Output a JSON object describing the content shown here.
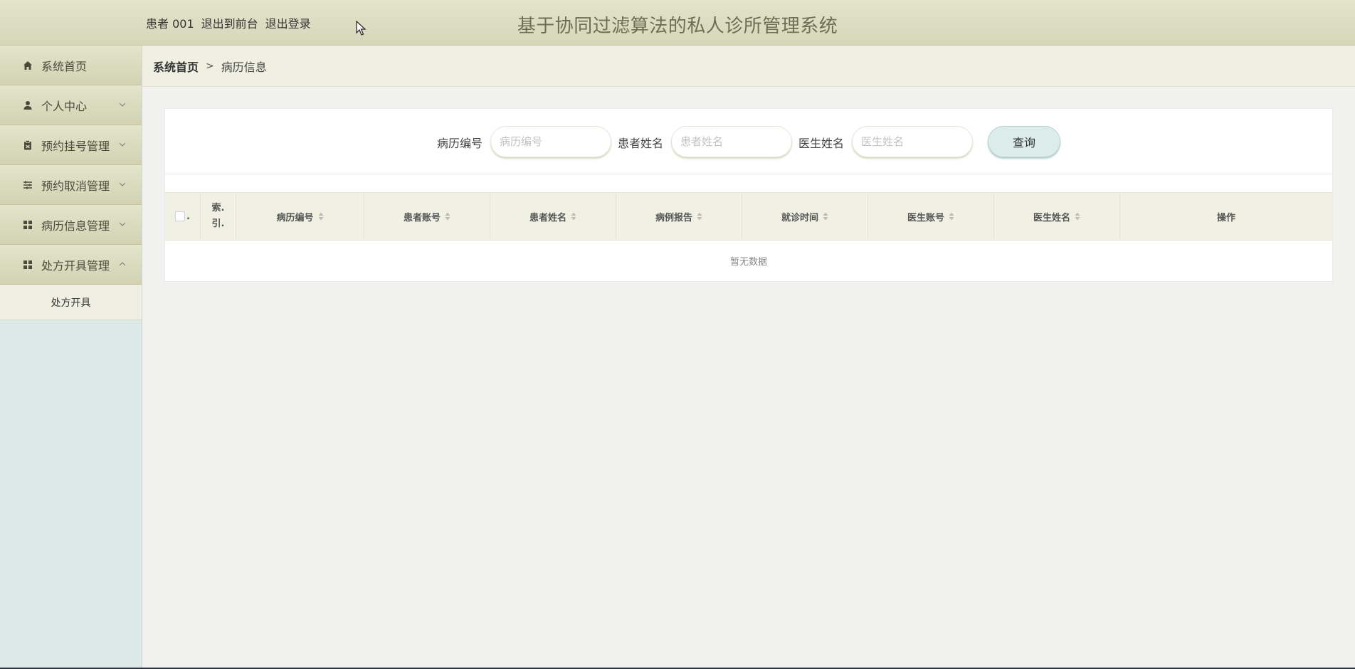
{
  "header": {
    "user_label": "患者 001",
    "front_link": "退出到前台",
    "logout_link": "退出登录",
    "system_title": "基于协同过滤算法的私人诊所管理系统"
  },
  "sidebar": {
    "items": [
      {
        "label": "系统首页",
        "icon": "home-icon"
      },
      {
        "label": "个人中心",
        "icon": "user-icon",
        "expanded": false
      },
      {
        "label": "预约挂号管理",
        "icon": "clipboard-icon",
        "expanded": false
      },
      {
        "label": "预约取消管理",
        "icon": "sliders-icon",
        "expanded": false
      },
      {
        "label": "病历信息管理",
        "icon": "grid-icon",
        "expanded": false
      },
      {
        "label": "处方开具管理",
        "icon": "grid-icon",
        "expanded": true
      }
    ],
    "sub_items": [
      "处方开具"
    ]
  },
  "breadcrumb": {
    "home": "系统首页",
    "separator": ">",
    "current": "病历信息"
  },
  "search": {
    "fields": [
      {
        "label": "病历编号",
        "placeholder": "病历编号",
        "value": ""
      },
      {
        "label": "患者姓名",
        "placeholder": "患者姓名",
        "value": ""
      },
      {
        "label": "医生姓名",
        "placeholder": "医生姓名",
        "value": ""
      }
    ],
    "button": "查询"
  },
  "table": {
    "columns": [
      "索引",
      "病历编号",
      "患者账号",
      "患者姓名",
      "病例报告",
      "就诊时间",
      "医生账号",
      "医生姓名",
      "操作"
    ],
    "index_header_lines": [
      "索.",
      "引."
    ],
    "empty_text": "暂无数据"
  },
  "colors": {
    "header_bg": "#dcdcc2",
    "sidebar_bg": "#dde9e7",
    "accent_button": "#dbecea",
    "title_color": "#6e6e52"
  }
}
